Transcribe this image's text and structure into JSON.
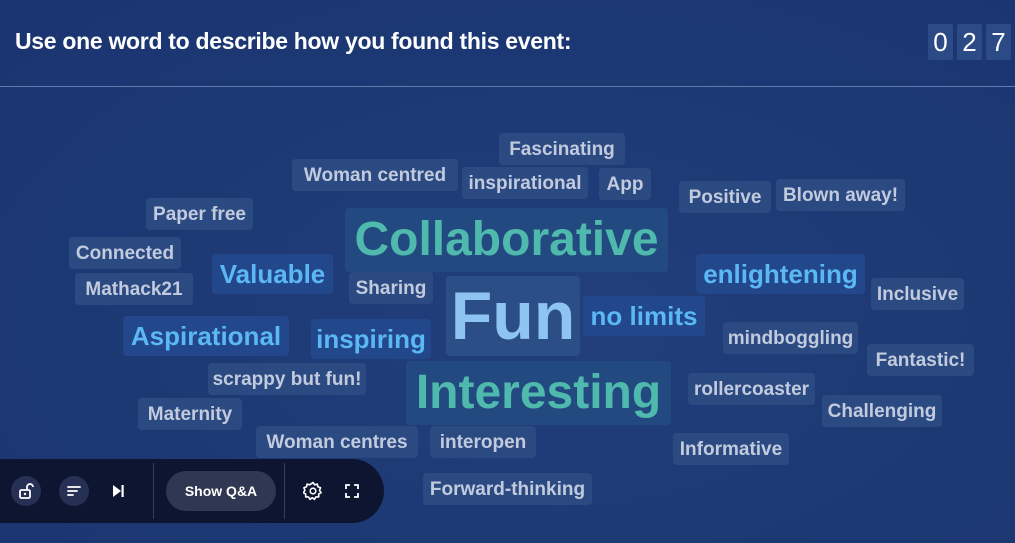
{
  "header": {
    "question": "Use one word to describe how you found this event:",
    "response_count_digits": [
      "0",
      "2",
      "7"
    ]
  },
  "word_cloud": {
    "words": [
      {
        "text": "Fascinating",
        "style": "grey"
      },
      {
        "text": "Woman centred",
        "style": "grey"
      },
      {
        "text": "inspirational",
        "style": "grey"
      },
      {
        "text": "App",
        "style": "grey"
      },
      {
        "text": "Positive",
        "style": "grey"
      },
      {
        "text": "Blown away!",
        "style": "grey"
      },
      {
        "text": "Paper free",
        "style": "grey"
      },
      {
        "text": "Collaborative",
        "style": "teal"
      },
      {
        "text": "Connected",
        "style": "grey"
      },
      {
        "text": "Valuable",
        "style": "blue"
      },
      {
        "text": "enlightening",
        "style": "blue"
      },
      {
        "text": "Mathack21",
        "style": "grey"
      },
      {
        "text": "Sharing",
        "style": "grey"
      },
      {
        "text": "Fun",
        "style": "fun"
      },
      {
        "text": "no limits",
        "style": "blue"
      },
      {
        "text": "Inclusive",
        "style": "grey"
      },
      {
        "text": "Aspirational",
        "style": "blue"
      },
      {
        "text": "inspiring",
        "style": "blue"
      },
      {
        "text": "mindboggling",
        "style": "grey"
      },
      {
        "text": "Fantastic!",
        "style": "grey"
      },
      {
        "text": "scrappy but fun!",
        "style": "grey"
      },
      {
        "text": "Interesting",
        "style": "teal"
      },
      {
        "text": "rollercoaster",
        "style": "grey"
      },
      {
        "text": "Maternity",
        "style": "grey"
      },
      {
        "text": "Challenging",
        "style": "grey"
      },
      {
        "text": "Woman centres",
        "style": "grey"
      },
      {
        "text": "interopen",
        "style": "grey"
      },
      {
        "text": "Informative",
        "style": "grey"
      },
      {
        "text": "Forward-thinking",
        "style": "grey"
      }
    ]
  },
  "toolbar": {
    "lock_icon": "unlock-icon",
    "sort_icon": "sort-lines-icon",
    "next_icon": "skip-next-icon",
    "show_qa_label": "Show Q&A",
    "settings_icon": "gear-icon",
    "fullscreen_icon": "fullscreen-icon"
  },
  "colors": {
    "background": "#1d3a75",
    "teal_word": "#4fb9ad",
    "blue_word": "#5bb8f4",
    "fun_word": "#8ec4f2",
    "grey_word": "#c2cbdd",
    "toolbar": "#0e1530"
  }
}
